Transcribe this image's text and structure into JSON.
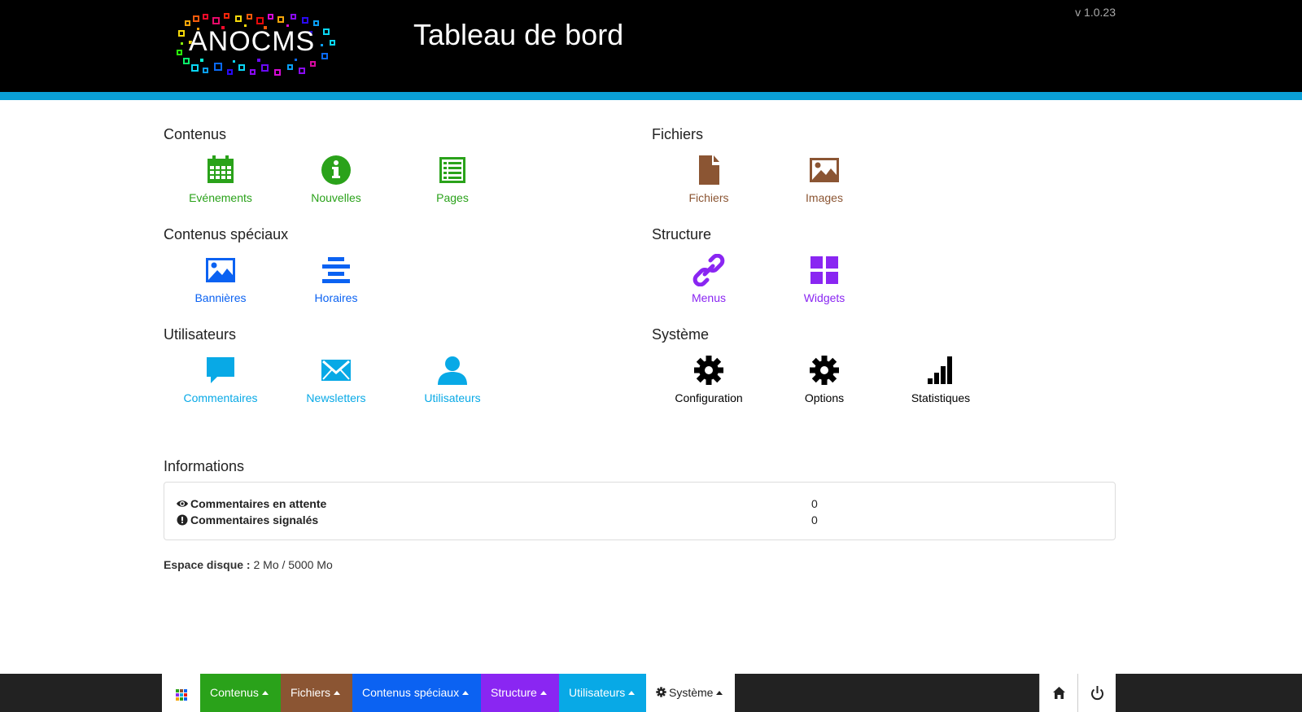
{
  "header": {
    "logo_text": "ANOCMS",
    "title": "Tableau de bord",
    "version": "v 1.0.23"
  },
  "colors": {
    "contenus": "#2aa21a",
    "fichiers": "#8b5533",
    "speciaux": "#0b62f2",
    "structure": "#8a26f2",
    "utilisateurs": "#08a9e6",
    "systeme": "#000000",
    "stripe": "#0a9fd6"
  },
  "sections": {
    "contenus": {
      "title": "Contenus",
      "items": [
        {
          "label": "Evénements",
          "icon": "calendar-icon"
        },
        {
          "label": "Nouvelles",
          "icon": "info-icon"
        },
        {
          "label": "Pages",
          "icon": "list-alt-icon"
        }
      ]
    },
    "fichiers": {
      "title": "Fichiers",
      "items": [
        {
          "label": "Fichiers",
          "icon": "file-icon"
        },
        {
          "label": "Images",
          "icon": "picture-icon"
        }
      ]
    },
    "speciaux": {
      "title": "Contenus spéciaux",
      "items": [
        {
          "label": "Bannières",
          "icon": "picture-icon"
        },
        {
          "label": "Horaires",
          "icon": "align-center-icon"
        }
      ]
    },
    "structure": {
      "title": "Structure",
      "items": [
        {
          "label": "Menus",
          "icon": "link-icon"
        },
        {
          "label": "Widgets",
          "icon": "grid-icon"
        }
      ]
    },
    "utilisateurs": {
      "title": "Utilisateurs",
      "items": [
        {
          "label": "Commentaires",
          "icon": "comment-icon"
        },
        {
          "label": "Newsletters",
          "icon": "envelope-icon"
        },
        {
          "label": "Utilisateurs",
          "icon": "user-icon"
        }
      ]
    },
    "systeme": {
      "title": "Système",
      "items": [
        {
          "label": "Configuration",
          "icon": "cog-icon"
        },
        {
          "label": "Options",
          "icon": "cog-icon"
        },
        {
          "label": "Statistiques",
          "icon": "signal-icon"
        }
      ]
    }
  },
  "informations": {
    "title": "Informations",
    "rows": [
      {
        "label": "Commentaires en attente",
        "value": "0",
        "icon": "eye-icon"
      },
      {
        "label": "Commentaires signalés",
        "value": "0",
        "icon": "alert-icon"
      }
    ],
    "disk_label": "Espace disque :",
    "disk_value": "2 Mo / 5000 Mo"
  },
  "bottombar": {
    "items": [
      {
        "label": "Contenus",
        "color": "#2aa21a"
      },
      {
        "label": "Fichiers",
        "color": "#8b5533"
      },
      {
        "label": "Contenus spéciaux",
        "color": "#0b62f2"
      },
      {
        "label": "Structure",
        "color": "#8a26f2"
      },
      {
        "label": "Utilisateurs",
        "color": "#08a9e6"
      },
      {
        "label": "Système",
        "color": "#ffffff"
      }
    ]
  }
}
